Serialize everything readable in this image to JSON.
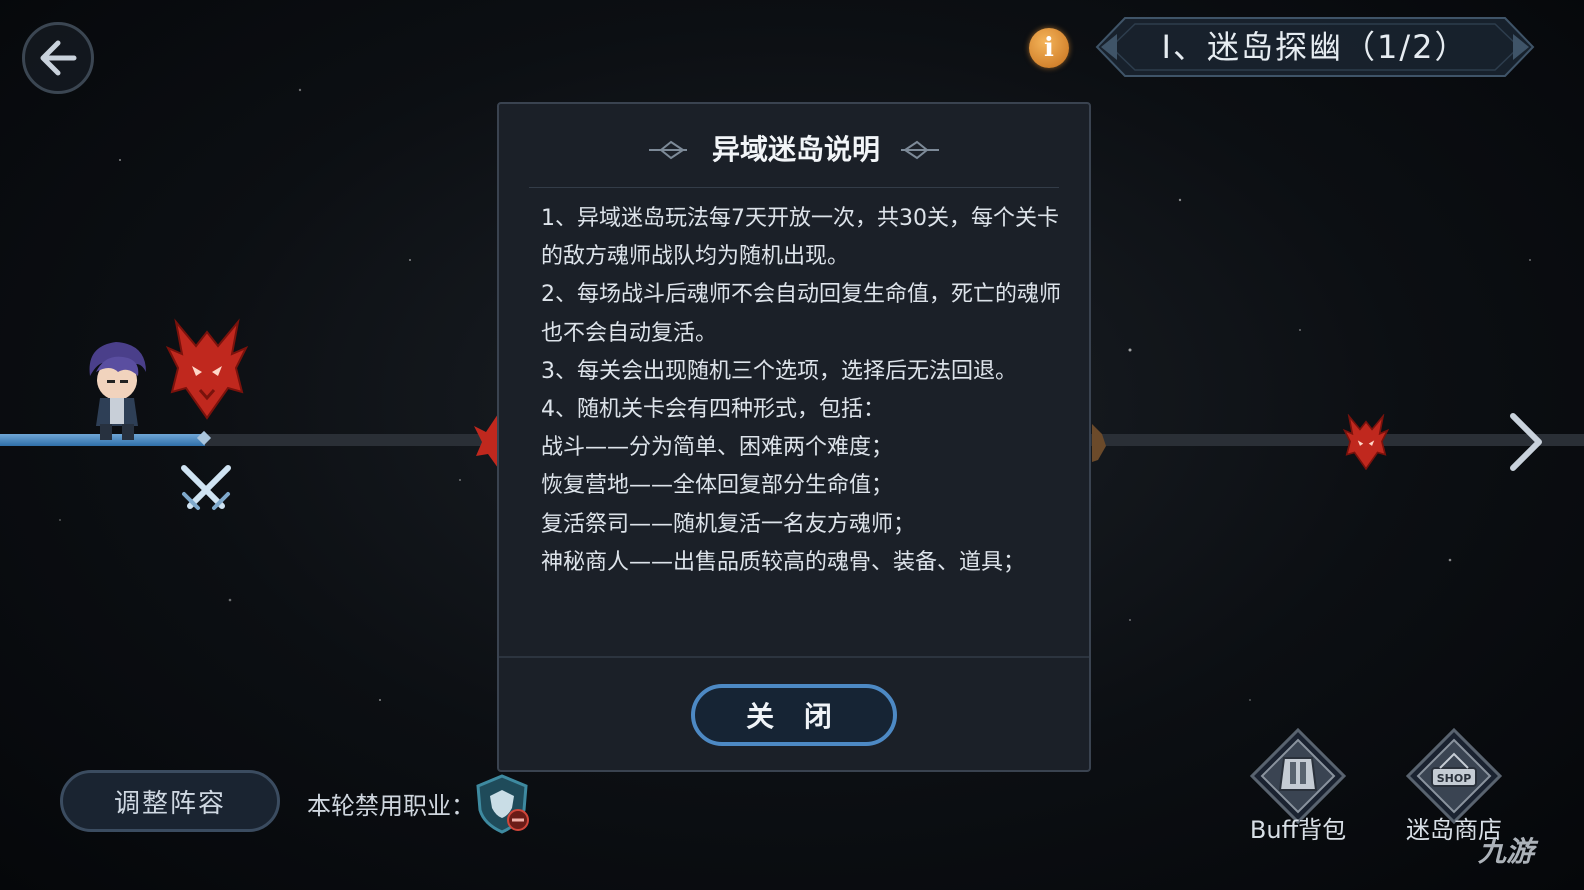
{
  "header": {
    "back_icon": "arrow-left-icon",
    "info_glyph": "i",
    "stage_title": "Ⅰ、迷岛探幽（1/2）"
  },
  "modal": {
    "title": "异域迷岛说明",
    "lines": [
      "1、异域迷岛玩法每7天开放一次，共30关，每个关卡的敌方魂师战队均为随机出现。",
      "2、每场战斗后魂师不会自动回复生命值，死亡的魂师也不会自动复活。",
      "3、每关会出现随机三个选项，选择后无法回退。",
      "4、随机关卡会有四种形式，包括：",
      "战斗——分为简单、困难两个难度；",
      "恢复营地——全体回复部分生命值；",
      "复活祭司——随机复活一名友方魂师；",
      "神秘商人——出售品质较高的魂骨、装备、道具；"
    ],
    "close_label": "关 闭"
  },
  "bottom": {
    "adjust_label": "调整阵容",
    "ban_label": "本轮禁用职业：",
    "buff_label": "Buff背包",
    "shop_label": "迷岛商店",
    "shop_sign": "SHOP"
  },
  "watermark": "九游",
  "colors": {
    "accent_blue": "#4d89c4",
    "info_orange": "#e08a2c",
    "demon_red": "#c0281e"
  }
}
